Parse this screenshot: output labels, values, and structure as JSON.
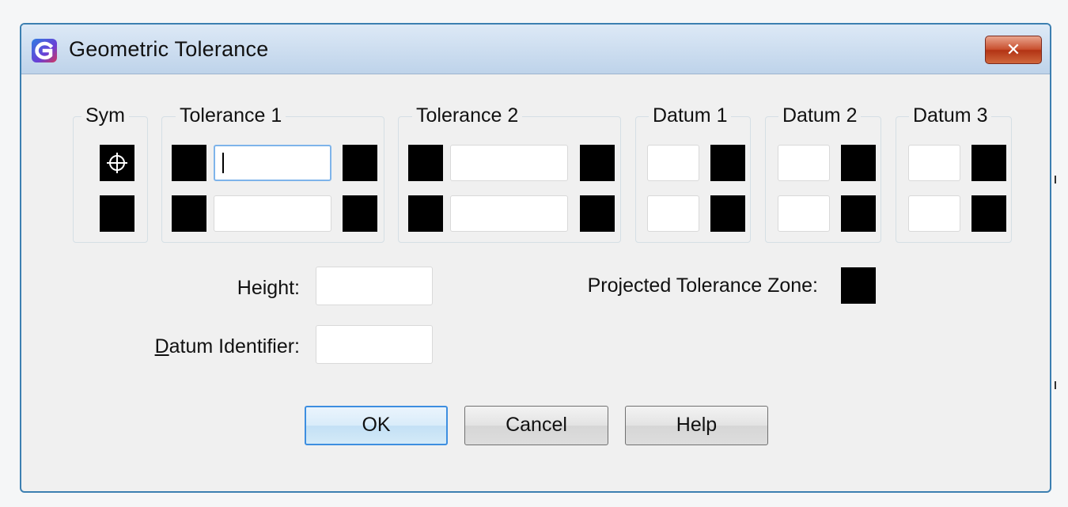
{
  "window": {
    "title": "Geometric Tolerance",
    "close_symbol": "✕",
    "app_icon": "app-logo-icon"
  },
  "groups": {
    "sym": "Sym",
    "tolerance1": "Tolerance 1",
    "tolerance2": "Tolerance 2",
    "datum1": "Datum 1",
    "datum2": "Datum 2",
    "datum3": "Datum 3"
  },
  "symbol_row1": "position-symbol-icon",
  "fields": {
    "tolerance1_row1": "",
    "tolerance1_row2": "",
    "tolerance2_row1": "",
    "tolerance2_row2": "",
    "datum1_row1": "",
    "datum1_row2": "",
    "datum2_row1": "",
    "datum2_row2": "",
    "datum3_row1": "",
    "datum3_row2": "",
    "height": "",
    "datum_identifier": ""
  },
  "labels": {
    "height": "Height:",
    "datum_identifier_mnemonic": "D",
    "datum_identifier_rest": "atum Identifier:",
    "projected_zone": "Projected Tolerance Zone:"
  },
  "buttons": {
    "ok": "OK",
    "cancel": "Cancel",
    "help": "Help"
  },
  "colors": {
    "title_gradient_top": "#dde9f6",
    "title_gradient_bottom": "#bed3ea",
    "window_border": "#3c7fb1",
    "close_button": "#c9502f",
    "focus_border": "#7eb4ea",
    "swatch": "#000000"
  }
}
